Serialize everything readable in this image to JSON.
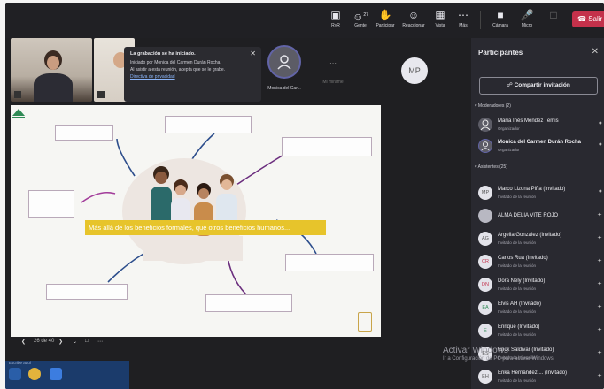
{
  "toolbar": {
    "buttons": [
      {
        "label": "RyR",
        "icon": "chat-icon"
      },
      {
        "label": "Gente",
        "icon": "people-icon",
        "badge": "27"
      },
      {
        "label": "Participar",
        "icon": "raise-hand-icon"
      },
      {
        "label": "Reaccionar",
        "icon": "reaction-icon"
      },
      {
        "label": "Vista",
        "icon": "view-icon"
      },
      {
        "label": "Más",
        "icon": "more-icon"
      }
    ],
    "camera_label": "Cámara",
    "mic_label": "Micro",
    "leave_label": "Salir",
    "leave_color": "#c4314b"
  },
  "toast": {
    "title": "La grabación se ha iniciado.",
    "line1": "Iniciado por Monica del Carmen Durán Rocha.",
    "line2": "Al asistir a esta reunión, acepta que se le grabe.",
    "link": "Directiva de privacidad"
  },
  "tiles": {
    "avatar_name_1": "Monica del Car...",
    "avatar_name_2": "Mi mirame",
    "mp_initials": "MP"
  },
  "slide": {
    "banner": "Más allá de los beneficios formales, qué otros beneficios humanos...",
    "banner_color": "#e7c42b",
    "page_counter": "26 de 40"
  },
  "panel": {
    "title": "Participantes",
    "share_label": "Compartir invitación",
    "moderators_header": "Moderadores (2)",
    "attendees_header": "Asistentes (25)",
    "moderators": [
      {
        "name": "María Inés Méndez Temis",
        "role": "Organizador",
        "initials": ""
      },
      {
        "name": "Monica del Carmen Durán Rocha",
        "role": "Organizador",
        "initials": ""
      }
    ],
    "attendees": [
      {
        "name": "Marco Lizona Piña (Invitado)",
        "role": "Invitado de la reunión",
        "initials": "MP"
      },
      {
        "name": "ALMA DELIA VITE ROJO",
        "role": "",
        "initials": ""
      },
      {
        "name": "Argelia González (Invitado)",
        "role": "Invitado de la reunión",
        "initials": "AG"
      },
      {
        "name": "Carlos Rua (Invitado)",
        "role": "Invitado de la reunión",
        "initials": "CR"
      },
      {
        "name": "Dora Nely (Invitado)",
        "role": "Invitado de la reunión",
        "initials": "DN"
      },
      {
        "name": "Elvis AH (Invitado)",
        "role": "Invitado de la reunión",
        "initials": "EA"
      },
      {
        "name": "Enrique (Invitado)",
        "role": "Invitado de la reunión",
        "initials": "E"
      },
      {
        "name": "Erick Saldivar (Invitado)",
        "role": "Invitado de la reunión",
        "initials": "ES"
      },
      {
        "name": "Erika Hernández ... (Invitado)",
        "role": "Invitado de la reunión",
        "initials": "EH"
      }
    ]
  },
  "windows": {
    "activate_title": "Activar Windows",
    "activate_sub": "Ir a Configuración de PC para activar Windows.",
    "search_text": "Escribe aquí"
  }
}
